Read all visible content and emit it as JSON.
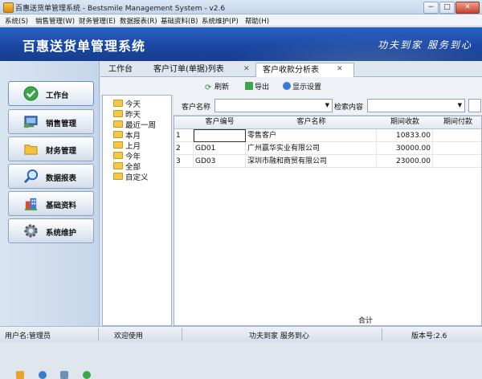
{
  "window": {
    "title": "百惠送货单管理系统 - Bestsmile Management System - v2.6",
    "minimize": "−",
    "maximize": "□",
    "close": "✕"
  },
  "menu": [
    "系统(S)",
    "销售管理(W)",
    "财务管理(E)",
    "数据报表(R)",
    "基础资料(B)",
    "系统维护(P)",
    "帮助(H)"
  ],
  "banner": {
    "app_title": "百惠送货单管理系统",
    "slogan": "功夫到家 服务到心"
  },
  "nav": [
    {
      "label": "工作台",
      "icon": "check-icon"
    },
    {
      "label": "销售管理",
      "icon": "monitor-icon"
    },
    {
      "label": "财务管理",
      "icon": "folder-icon"
    },
    {
      "label": "数据报表",
      "icon": "magnifier-icon"
    },
    {
      "label": "基础资料",
      "icon": "building-icon"
    },
    {
      "label": "系统维护",
      "icon": "gear-icon"
    }
  ],
  "tabs": [
    {
      "label": "工作台"
    },
    {
      "label": "客户订单(单据)列表"
    },
    {
      "label": "客户收款分析表"
    }
  ],
  "toolbar": {
    "refresh": "刷新",
    "export": "导出",
    "display": "显示设置"
  },
  "tree": [
    "今天",
    "昨天",
    "最近一周",
    "本月",
    "上月",
    "今年",
    "全部",
    "自定义"
  ],
  "filter": {
    "customer_label": "客户名称",
    "customer_value": "",
    "search_label": "检索内容",
    "search_value": ""
  },
  "grid": {
    "columns": [
      "客户编号",
      "客户名称",
      "期间收款",
      "期间付款"
    ],
    "rows": [
      {
        "no": "1",
        "code": "",
        "name": "零售客户",
        "recv": "10833.00",
        "pay": ""
      },
      {
        "no": "2",
        "code": "GD01",
        "name": "广州赢华实业有限公司",
        "recv": "30000.00",
        "pay": ""
      },
      {
        "no": "3",
        "code": "GD03",
        "name": "深圳市融和商贸有限公司",
        "recv": "23000.00",
        "pay": ""
      }
    ],
    "total_label": "合计"
  },
  "status": {
    "user": "用户名:管理员",
    "welcome": "欢迎使用",
    "slogan": "功夫到家 服务到心",
    "version": "版本号:2.6"
  },
  "colors": {
    "banner": "#1a47a3",
    "nav_bg": "#d9e4f1"
  }
}
